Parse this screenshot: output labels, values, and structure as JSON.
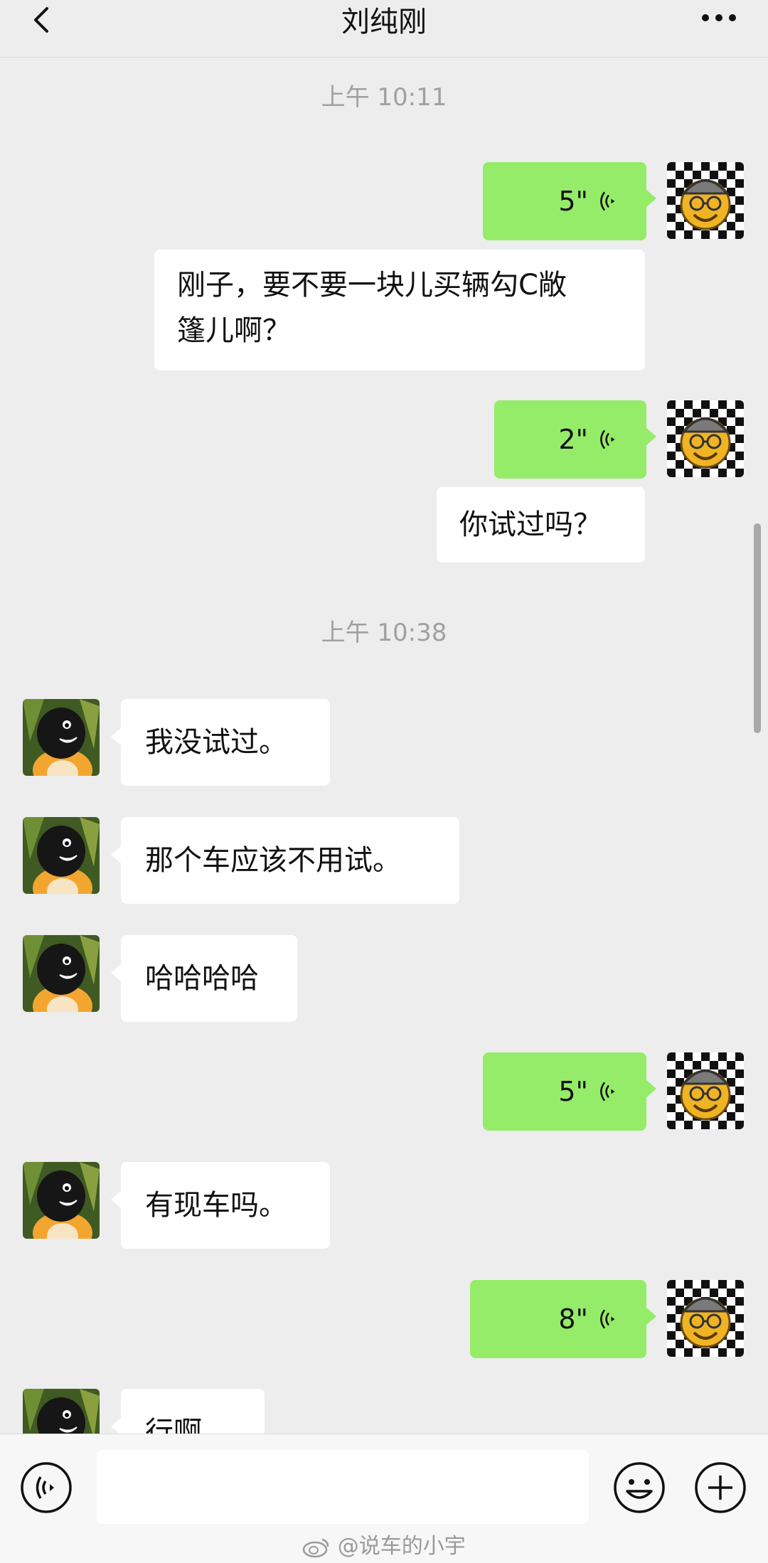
{
  "header": {
    "title": "刘纯刚"
  },
  "messages": {
    "ts1": "上午 10:11",
    "m1": {
      "duration": "5\""
    },
    "m2": {
      "line1": "刚子，要不要一块儿买辆勾C敞",
      "line2": "篷儿啊？"
    },
    "m3": {
      "duration": "2\""
    },
    "m4": {
      "text": "你试过吗？"
    },
    "ts2": "上午 10:38",
    "m5": {
      "text": "我没试过。"
    },
    "m6": {
      "text": "那个车应该不用试。"
    },
    "m7": {
      "text": "哈哈哈哈"
    },
    "m8": {
      "duration": "5\""
    },
    "m9": {
      "text": "有现车吗。"
    },
    "m10": {
      "duration": "8\""
    },
    "m11": {
      "text": "行啊"
    }
  },
  "footer": {
    "watermark": "@说车的小宇"
  },
  "colors": {
    "self_bubble": "#95ec69",
    "other_bubble": "#ffffff",
    "background": "#ededed"
  },
  "icons": [
    "back-icon",
    "more-icon",
    "voice-wave-icon",
    "voice-input-icon",
    "emoji-icon",
    "plus-icon",
    "weibo-icon"
  ]
}
